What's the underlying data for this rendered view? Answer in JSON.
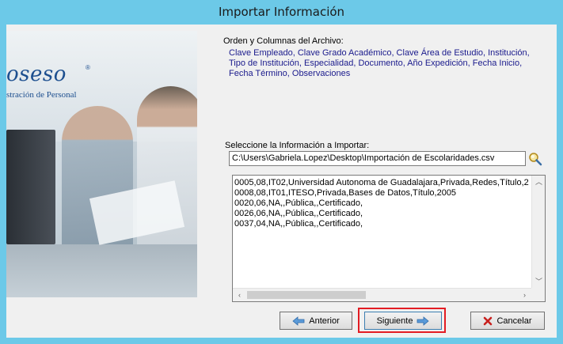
{
  "window": {
    "title": "Importar Información"
  },
  "branding": {
    "logo_text": "oseso",
    "registered_mark": "®",
    "tagline": "stración de Personal"
  },
  "file_format": {
    "label": "Orden y Columnas del Archivo:",
    "columns_text": "Clave Empleado, Clave Grado Académico, Clave Área de Estudio, Institución, Tipo de Institución, Especialidad, Documento, Año Expedición, Fecha Inicio, Fecha Término, Observaciones"
  },
  "file_select": {
    "label": "Seleccione la Información a Importar:",
    "path": "C:\\Users\\Gabriela.Lopez\\Desktop\\Importación de Escolaridades.csv",
    "search_icon": "magnifier-icon"
  },
  "preview": {
    "lines": [
      "0005,08,IT02,Universidad Autonoma de Guadalajara,Privada,Redes,Título,20",
      "0008,08,IT01,ITESO,Privada,Bases de Datos,Título,2005",
      "0020,06,NA,,Pública,,Certificado,",
      "0026,06,NA,,Pública,,Certificado,",
      "0037,04,NA,,Pública,,Certificado,"
    ]
  },
  "buttons": {
    "previous": {
      "label": "Anterior",
      "icon": "arrow-left-icon"
    },
    "next": {
      "label": "Siguiente",
      "icon": "arrow-right-icon"
    },
    "cancel": {
      "label": "Cancelar",
      "icon": "close-x-icon"
    }
  },
  "colors": {
    "title_bar": "#6cc9e8",
    "columns_text": "#1a1a8c",
    "highlight_outline": "#e31c23",
    "cancel_icon": "#c8201e",
    "arrow_icon": "#4a90d9"
  }
}
